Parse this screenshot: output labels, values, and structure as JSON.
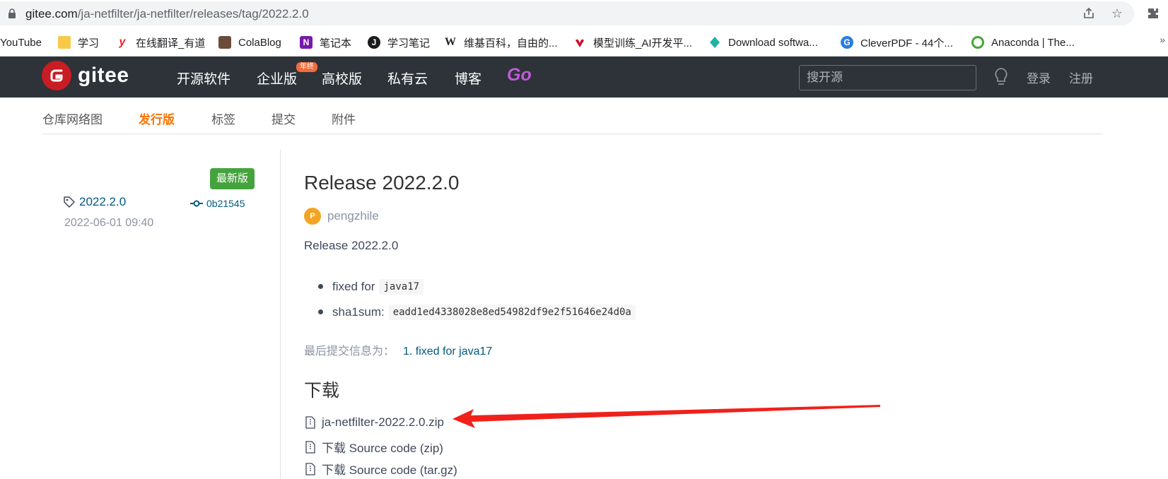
{
  "browser": {
    "url_host": "gitee.com",
    "url_path": "/ja-netfilter/ja-netfilter/releases/tag/2022.2.0"
  },
  "bookmarks": [
    {
      "label": "YouTube",
      "icon": "youtube-icon"
    },
    {
      "label": "学习",
      "icon": "folder-icon",
      "color": "#f9c94a"
    },
    {
      "label": "在线翻译_有道",
      "icon": "youdao-icon",
      "color": "#e8232b"
    },
    {
      "label": "ColaBlog",
      "icon": "colablog-icon",
      "color": "#6b4b3a"
    },
    {
      "label": "笔记本",
      "icon": "onenote-icon",
      "color": "#7719aa"
    },
    {
      "label": "学习笔记",
      "icon": "notes-icon",
      "color": "#1b1b1b"
    },
    {
      "label": "维基百科，自由的...",
      "icon": "wikipedia-icon"
    },
    {
      "label": "模型训练_AI开发平...",
      "icon": "huawei-icon",
      "color": "#cf0a2c"
    },
    {
      "label": "Download softwa...",
      "icon": "diamond-icon",
      "color": "#1fb4a5"
    },
    {
      "label": "CleverPDF - 44个...",
      "icon": "cleverpdf-icon",
      "color": "#2a7de1"
    },
    {
      "label": "Anaconda | The...",
      "icon": "anaconda-icon",
      "color": "#44a833"
    }
  ],
  "header": {
    "logo_text": "gitee",
    "nav": [
      "开源软件",
      "企业版",
      "高校版",
      "私有云",
      "博客"
    ],
    "nav_badge": "年终",
    "go_label": "Go",
    "search_placeholder": "搜开源",
    "login": "登录",
    "register": "注册",
    "brand_color": "#c71d23"
  },
  "subnav": {
    "tabs": [
      "仓库网络图",
      "发行版",
      "标签",
      "提交",
      "附件"
    ],
    "active": "发行版"
  },
  "release_meta": {
    "latest_badge": "最新版",
    "tag": "2022.2.0",
    "commit": "0b21545",
    "date": "2022-06-01 09:40"
  },
  "release": {
    "title": "Release 2022.2.0",
    "author_initial": "P",
    "author": "pengzhile",
    "description": "Release 2022.2.0",
    "notes": [
      {
        "text": "fixed for",
        "code": "java17"
      },
      {
        "text": "sha1sum:",
        "code": "eadd1ed4338028e8ed54982df9e2f51646e24d0a"
      }
    ],
    "last_commit_label": "最后提交信息为：",
    "last_commit_value": "1. fixed for java17",
    "download_title": "下载",
    "downloads": [
      "ja-netfilter-2022.2.0.zip",
      "下载 Source code (zip)",
      "下载 Source code (tar.gz)"
    ]
  }
}
